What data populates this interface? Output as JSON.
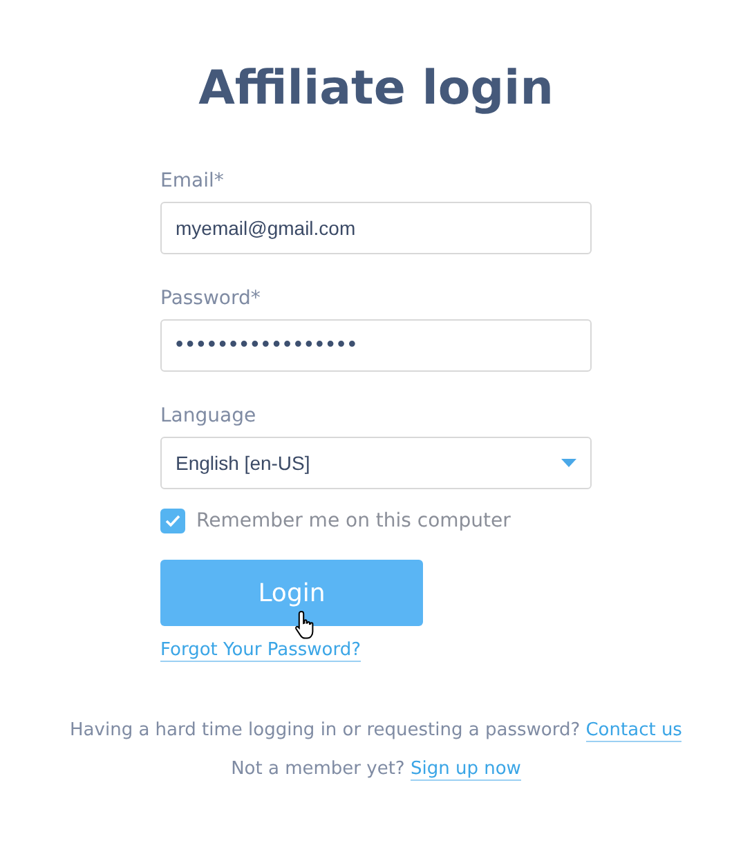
{
  "title": "Affiliate login",
  "fields": [
    {
      "label": "Email*",
      "value": "myemail@gmail.com",
      "kind": "text"
    },
    {
      "label": "Password*",
      "value": "•••••••••••••••••",
      "kind": "password"
    },
    {
      "label": "Language",
      "value": "English [en-US]",
      "kind": "select"
    }
  ],
  "remember": {
    "label": "Remember me on this computer",
    "checked": true
  },
  "login_button": "Login",
  "forgot_link": "Forgot Your Password?",
  "footer": [
    {
      "text": "Having a hard time logging in or requesting a password?",
      "link": "Contact us"
    },
    {
      "text": "Not a member yet?",
      "link": "Sign up now"
    }
  ]
}
